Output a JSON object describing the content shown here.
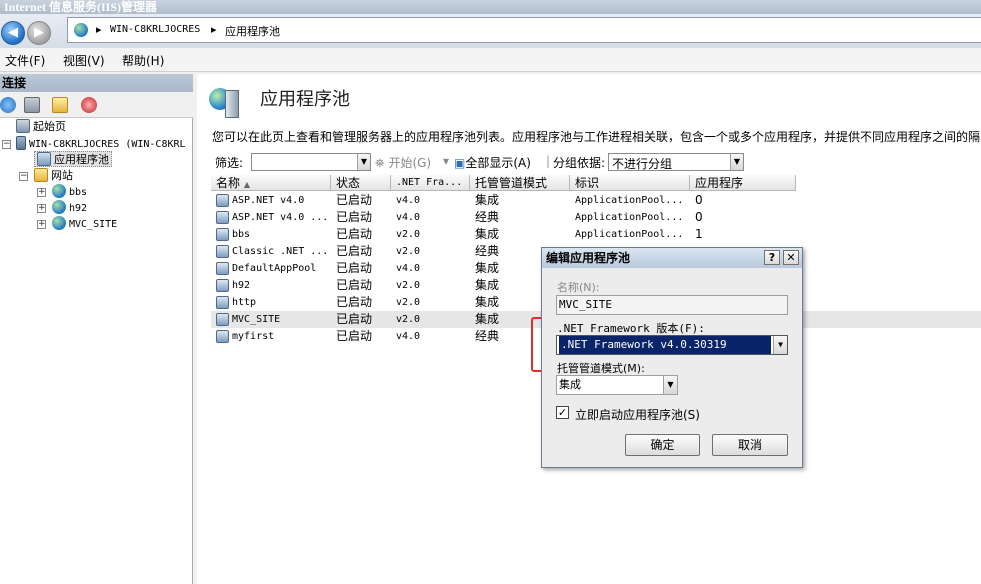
{
  "window": {
    "title": "Internet 信息服务(IIS)管理器"
  },
  "address": {
    "server": "WIN-C8KRLJOCRES",
    "sep": "▸",
    "page": "应用程序池"
  },
  "menu": {
    "file": "文件(F)",
    "view": "视图(V)",
    "help": "帮助(H)"
  },
  "connections": {
    "title": "连接",
    "tree": {
      "start": "起始页",
      "server": "WIN-C8KRLJOCRES (WIN-C8KRL",
      "pools": "应用程序池",
      "sites": "网站",
      "site1": "bbs",
      "site2": "h92",
      "site3": "MVC_SITE"
    }
  },
  "main": {
    "title": "应用程序池",
    "description": "您可以在此页上查看和管理服务器上的应用程序池列表。应用程序池与工作进程相关联，包含一个或多个应用程序，并提供不同应用程序之间的隔",
    "filter_label": "筛选:",
    "start_label": "开始(G)",
    "show_all": "全部显示(A)",
    "group_label": "分组依据:",
    "group_value": "不进行分组"
  },
  "table": {
    "headers": {
      "name": "名称",
      "status": "状态",
      "net": ".NET Fra...",
      "pipeline": "托管管道模式",
      "identity": "标识",
      "apps": "应用程序"
    },
    "rows": [
      {
        "name": "ASP.NET v4.0",
        "status": "已启动",
        "net": "v4.0",
        "pipeline": "集成",
        "identity": "ApplicationPool...",
        "apps": "0"
      },
      {
        "name": "ASP.NET v4.0 ...",
        "status": "已启动",
        "net": "v4.0",
        "pipeline": "经典",
        "identity": "ApplicationPool...",
        "apps": "0"
      },
      {
        "name": "bbs",
        "status": "已启动",
        "net": "v2.0",
        "pipeline": "集成",
        "identity": "ApplicationPool...",
        "apps": "1"
      },
      {
        "name": "Classic .NET ...",
        "status": "已启动",
        "net": "v2.0",
        "pipeline": "经典",
        "identity": "",
        "apps": ""
      },
      {
        "name": "DefaultAppPool",
        "status": "已启动",
        "net": "v4.0",
        "pipeline": "集成",
        "identity": "",
        "apps": ""
      },
      {
        "name": "h92",
        "status": "已启动",
        "net": "v2.0",
        "pipeline": "集成",
        "identity": "",
        "apps": ""
      },
      {
        "name": "http",
        "status": "已启动",
        "net": "v2.0",
        "pipeline": "集成",
        "identity": "",
        "apps": ""
      },
      {
        "name": "MVC_SITE",
        "status": "已启动",
        "net": "v2.0",
        "pipeline": "集成",
        "identity": "",
        "apps": ""
      },
      {
        "name": "myfirst",
        "status": "已启动",
        "net": "v4.0",
        "pipeline": "经典",
        "identity": "",
        "apps": ""
      }
    ]
  },
  "dialog": {
    "title": "编辑应用程序池",
    "help": "?",
    "close": "✕",
    "name_label": "名称(N):",
    "name_value": "MVC_SITE",
    "framework_label": ".NET Framework 版本(F):",
    "framework_value": ".NET Framework v4.0.30319",
    "pipeline_label": "托管管道模式(M):",
    "pipeline_value": "集成",
    "autostart_label": "立即启动应用程序池(S)",
    "ok": "确定",
    "cancel": "取消"
  },
  "colors": {
    "highlight": "#e62b2b",
    "selection": "#0a246a"
  }
}
